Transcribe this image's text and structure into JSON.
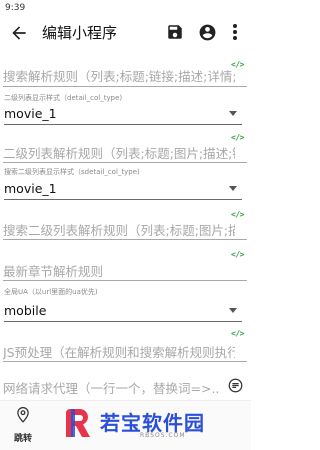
{
  "status": {
    "time": "9:39"
  },
  "appbar": {
    "title": "编辑小程序",
    "back_icon": "arrow-left-icon",
    "save_icon": "save-icon",
    "account_icon": "account-circle-icon",
    "more_icon": "more-vertical-icon"
  },
  "fields": {
    "search_rule": {
      "placeholder": "搜索解析规则（列表;标题;链接;描述;详情;图片）"
    },
    "detail_col_type": {
      "label": "二级列表显示样式（detail_col_type)",
      "value": "movie_1"
    },
    "detail_rule": {
      "placeholder": "二级列表解析规则（列表;标题;图片;描述;链接）"
    },
    "sdetail_col_type": {
      "label": "搜索二级列表显示样式（sdetail_col_type)",
      "value": "movie_1"
    },
    "sdetail_rule": {
      "placeholder": "搜索二级列表解析规则（列表;标题;图片;描述）"
    },
    "last_chapter_rule": {
      "placeholder": "最新章节解析规则"
    },
    "ua": {
      "label": "全局UA（以url里面的ua优先)",
      "value": "mobile"
    },
    "preprocess": {
      "placeholder": "JS预处理（在解析规则和搜索解析规则执行前）"
    },
    "proxy": {
      "placeholder": "网络请求代理（一行一个，替换词=>..."
    }
  },
  "code_icon_text": "</>",
  "bottom_nav": {
    "jump_label": "跳转",
    "jump_icon": "location-pin-icon"
  },
  "watermark": {
    "name": "若宝软件园",
    "url": "RBSOS.COM"
  },
  "colors": {
    "accent_green": "#3aa14a",
    "brand_blue": "#2b4fd6",
    "brand_red": "#e8344a"
  }
}
